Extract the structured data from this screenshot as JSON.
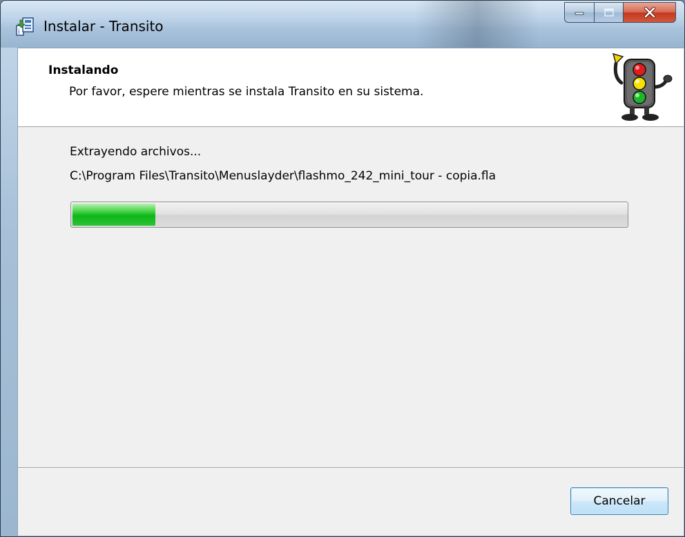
{
  "window": {
    "title": "Instalar - Transito",
    "icon": "installer-app-icon",
    "controls": {
      "minimize_icon": "minimize-icon",
      "maximize_icon": "maximize-icon",
      "close_icon": "close-icon"
    }
  },
  "header": {
    "title": "Instalando",
    "subtitle": "Por favor, espere mientras se instala Transito en su sistema.",
    "image": "traffic-light-mascot"
  },
  "main": {
    "status": "Extrayendo archivos...",
    "current_file": "C:\\Program Files\\Transito\\Menuslayder\\flashmo_242_mini_tour - copia.fla",
    "progress": {
      "fraction": 0.15,
      "color": "#1dbb28"
    }
  },
  "footer": {
    "cancel_label": "Cancelar"
  },
  "colors": {
    "client_bg": "#f0f0f0",
    "header_bg": "#ffffff",
    "close_button": "#c2391d",
    "button_border": "#3c7fb1"
  }
}
